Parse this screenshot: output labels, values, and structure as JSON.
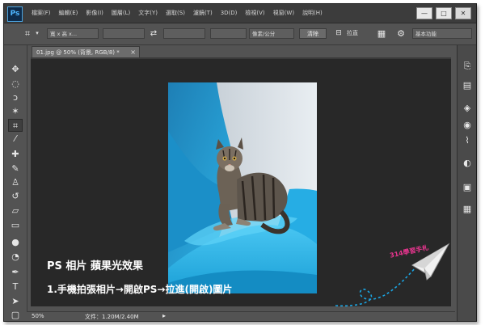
{
  "app": {
    "logo": "Ps"
  },
  "menu": [
    "檔案(F)",
    "編輯(E)",
    "影像(I)",
    "圖層(L)",
    "文字(Y)",
    "選取(S)",
    "濾鏡(T)",
    "3D(D)",
    "檢視(V)",
    "視窗(W)",
    "說明(H)"
  ],
  "window_controls": {
    "minimize": "—",
    "restore": "□",
    "close": "✕"
  },
  "options_bar": {
    "crop_icon": "crop-icon",
    "ratio_select": "寬 x 高 x...",
    "swap_symbol": "⇄",
    "unit_select": "像素/公分",
    "clear_button": "清除",
    "straighten_label": "拉直",
    "workspace_select": "基本功能"
  },
  "document": {
    "tab_label": "01.jpg @ 50% (背景, RGB/8) *",
    "zoom": "50%",
    "doc_info": "文件：1.20M/2.40M"
  },
  "captions": {
    "title": "PS 相片 蘋果光效果",
    "steps": "1.手機拍張相片→開啟PS→拉進(開啟)圖片"
  },
  "stamp": {
    "text": "314學習手札"
  },
  "tools": [
    "move-tool-icon",
    "marquee-tool-icon",
    "lasso-tool-icon",
    "magic-wand-tool-icon",
    "crop-tool-icon",
    "eyedropper-tool-icon",
    "healing-brush-tool-icon",
    "brush-tool-icon",
    "clone-stamp-tool-icon",
    "history-brush-tool-icon",
    "eraser-tool-icon",
    "gradient-tool-icon",
    "blur-tool-icon",
    "dodge-tool-icon",
    "pen-tool-icon",
    "type-tool-icon",
    "path-selection-tool-icon",
    "shape-tool-icon",
    "hand-tool-icon",
    "zoom-tool-icon"
  ],
  "dock_icons": [
    "history-panel-icon",
    "properties-panel-icon",
    "layers-panel-icon",
    "channels-panel-icon",
    "paths-panel-icon",
    "adjustments-panel-icon",
    "styles-panel-icon",
    "libraries-panel-icon"
  ],
  "colors": {
    "app_bg": "#535353",
    "canvas_bg": "#282828",
    "menubar_bg": "#3c3c3c",
    "accent": "#4fb6ff",
    "pillow": "#2fb3e4",
    "stamp": "#e8358f"
  }
}
